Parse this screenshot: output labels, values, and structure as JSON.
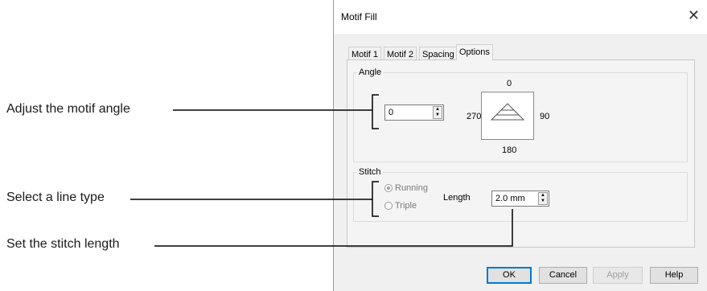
{
  "callouts": [
    "Adjust the motif angle",
    "Select a line type",
    "Set the stitch length"
  ],
  "dialog": {
    "title": "Motif Fill",
    "close_glyph": "✕",
    "tabs": [
      "Motif 1",
      "Motif 2",
      "Spacing",
      "Options"
    ],
    "active_tab": "Options",
    "angle_group": {
      "label": "Angle",
      "value": "0",
      "compass": {
        "top": "0",
        "right": "90",
        "bottom": "180",
        "left": "270"
      }
    },
    "stitch_group": {
      "label": "Stitch",
      "options": [
        "Running",
        "Triple"
      ],
      "selected": "Running",
      "length_label": "Length",
      "length_value": "2.0 mm"
    },
    "buttons": {
      "ok": "OK",
      "cancel": "Cancel",
      "apply": "Apply",
      "help": "Help"
    }
  },
  "colors": {
    "accent": "#0078d7",
    "callout_line": "#000000"
  }
}
